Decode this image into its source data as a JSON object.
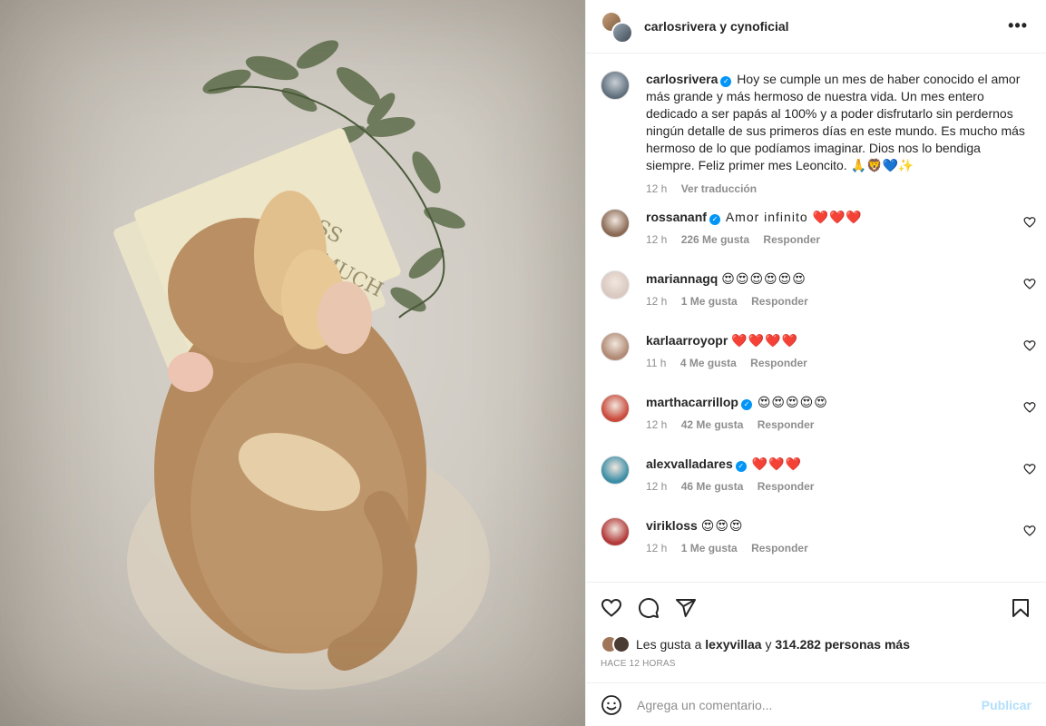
{
  "header": {
    "title": "carlosrivera y cynoficial"
  },
  "caption": {
    "username": "carlosrivera",
    "text": "Hoy se cumple un mes de haber conocido el amor más grande y más hermoso de nuestra vida. Un mes entero dedicado a ser papás al 100% y a poder disfrutarlo sin perdernos ningún detalle de sus primeros días en este mundo. Es mucho más hermoso de lo que podíamos imaginar. Dios nos lo bendiga siempre. Feliz primer mes Leoncito. 🙏🦁💙✨",
    "time": "12 h",
    "translate": "Ver traducción"
  },
  "comments": [
    {
      "username": "rossananf",
      "verified": true,
      "text": "Amor infinito ❤️❤️❤️",
      "time": "12 h",
      "likes": "226 Me gusta",
      "reply": "Responder",
      "avatar_color": "#8a6a55"
    },
    {
      "username": "mariannagq",
      "verified": false,
      "text": "😍😍😍😍😍😍",
      "time": "12 h",
      "likes": "1 Me gusta",
      "reply": "Responder",
      "avatar_color": "#d9c9c0"
    },
    {
      "username": "karlaarroyopr",
      "verified": false,
      "text": "❤️❤️❤️❤️",
      "time": "11 h",
      "likes": "4 Me gusta",
      "reply": "Responder",
      "avatar_color": "#b08a74"
    },
    {
      "username": "marthacarrillop",
      "verified": true,
      "text": "😍😍😍😍😍",
      "time": "12 h",
      "likes": "42 Me gusta",
      "reply": "Responder",
      "avatar_color": "#c94a3b"
    },
    {
      "username": "alexvalladares",
      "verified": true,
      "text": "❤️❤️❤️",
      "time": "12 h",
      "likes": "46 Me gusta",
      "reply": "Responder",
      "avatar_color": "#3c8ea6"
    },
    {
      "username": "virikloss",
      "verified": false,
      "text": "😍😍😍",
      "time": "12 h",
      "likes": "1 Me gusta",
      "reply": "Responder",
      "avatar_color": "#b23a3a"
    }
  ],
  "likes": {
    "prefix": "Les gusta a",
    "user": "lexyvillaa",
    "connector": "y",
    "count": "314.282 personas más"
  },
  "timeago": "HACE 12 HORAS",
  "add_comment": {
    "placeholder": "Agrega un comentario...",
    "publish": "Publicar"
  },
  "colors": {
    "verified": "#0095f6",
    "heart_red": "#ed4956",
    "publish_disabled": "#b2dffc"
  }
}
